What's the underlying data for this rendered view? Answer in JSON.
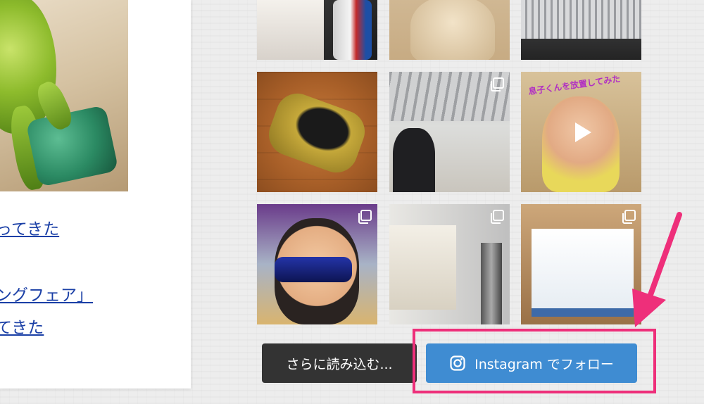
{
  "sidebar_article": {
    "links": [
      "ってきた",
      "ングフェア」",
      "てきた"
    ]
  },
  "instagram_feed": {
    "tiles": [
      {
        "name": "toy-box-and-drink",
        "badge": "none"
      },
      {
        "name": "doll-figure",
        "badge": "none"
      },
      {
        "name": "air-conditioner-unit",
        "badge": "none"
      },
      {
        "name": "gold-toy-car",
        "badge": "none"
      },
      {
        "name": "airport-hallway",
        "badge": "gallery-icon"
      },
      {
        "name": "kid-with-sunglasses-video",
        "badge": "play-icon",
        "caption": "息子くんを放置してみた"
      },
      {
        "name": "kid-with-blue-sunglasses",
        "badge": "gallery-icon"
      },
      {
        "name": "wall-shelf-decor",
        "badge": "gallery-icon"
      },
      {
        "name": "product-box",
        "badge": "gallery-icon"
      }
    ],
    "load_more_label": "さらに読み込む...",
    "follow_label": "Instagram でフォロー"
  },
  "colors": {
    "follow_button": "#3f8cd2",
    "load_more_button": "#333333",
    "annotation": "#ee2f7a",
    "link": "#1a3fa6"
  },
  "icons": {
    "follow_button_icon": "instagram-icon",
    "gallery_badge": "gallery-icon",
    "video_badge": "play-icon",
    "annotation": "arrow-icon"
  }
}
